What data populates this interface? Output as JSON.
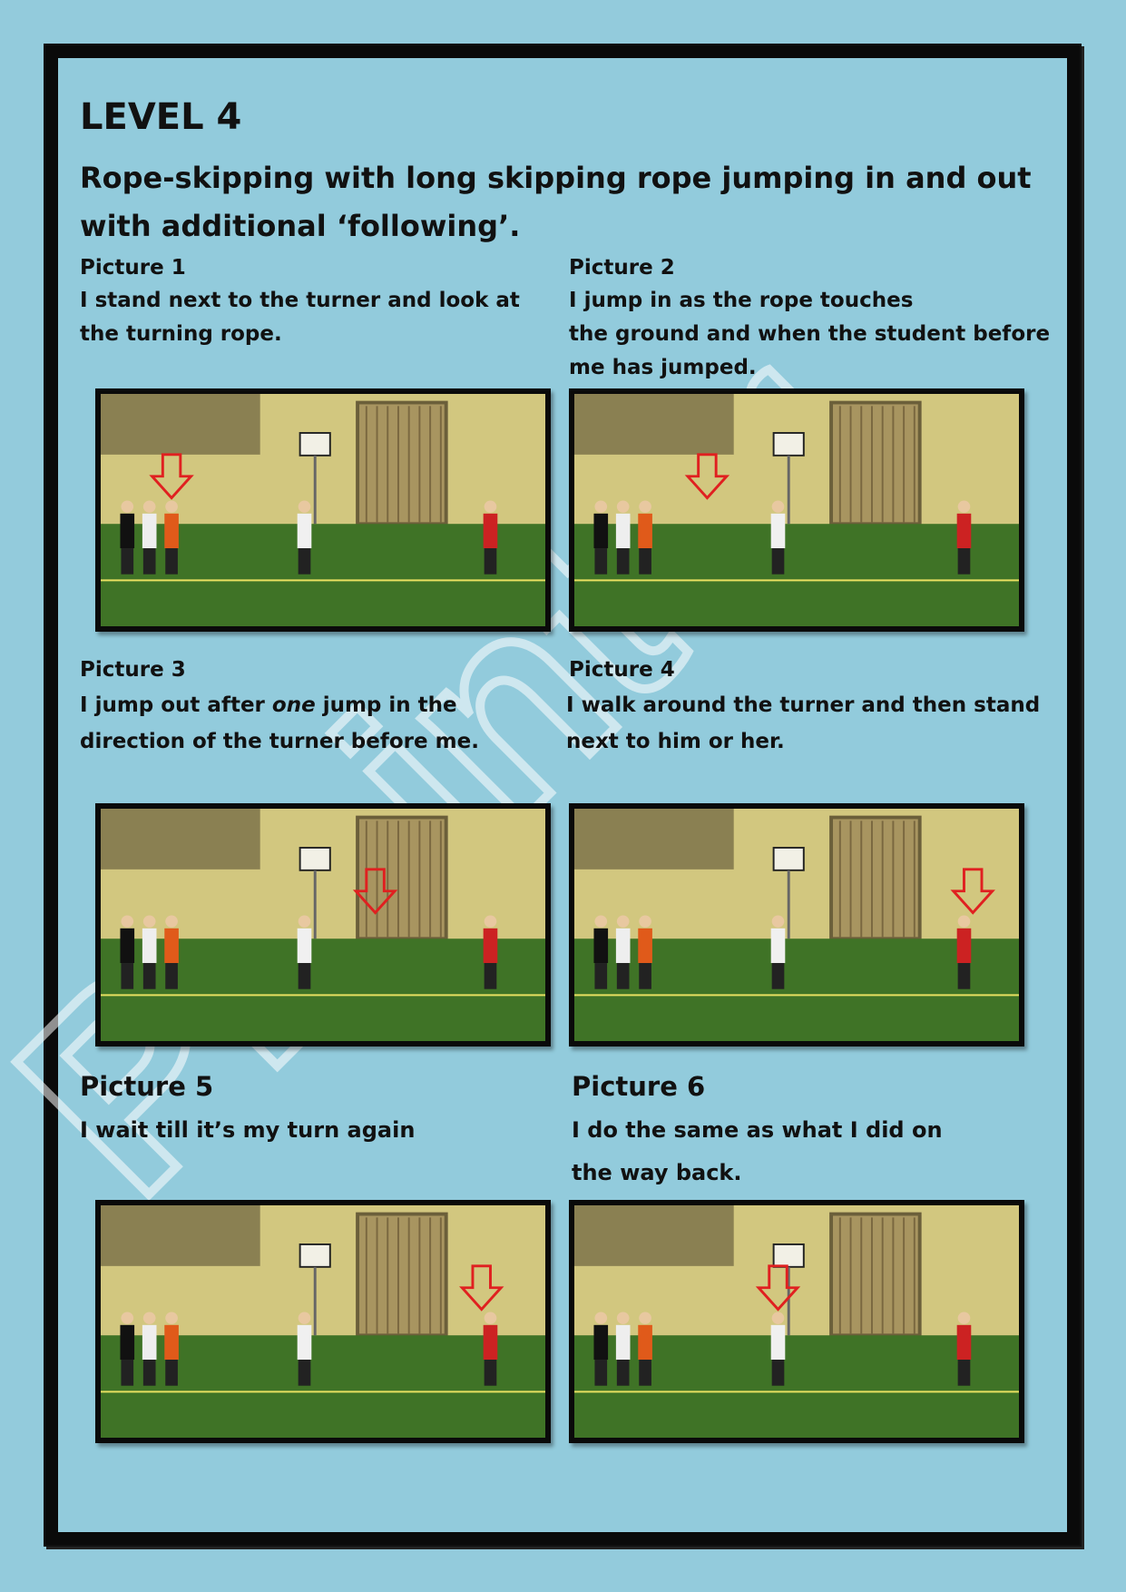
{
  "header": {
    "level": "LEVEL 4",
    "subtitle": "Rope-skipping with long skipping rope jumping in and out with additional ‘following’."
  },
  "watermark": {
    "text": "PE-inter",
    "color": "#ffffff"
  },
  "pictures": [
    {
      "label": "Picture 1",
      "lines": [
        "I stand next to the turner and look at",
        "the turning rope."
      ]
    },
    {
      "label": "Picture 2",
      "lines": [
        "I jump in as the rope touches",
        "the ground and when the student before",
        "me has jumped."
      ]
    },
    {
      "label": "Picture 3",
      "lines_rich": {
        "before": "I jump out after ",
        "emphasis": "one",
        "after": " jump in the"
      },
      "lines": [
        "direction of the turner before me."
      ]
    },
    {
      "label": "Picture 4",
      "lines": [
        "I walk around the turner and then stand",
        "next to him or her."
      ]
    },
    {
      "label": "Picture 5",
      "lines": [
        "I wait till it’s my turn again"
      ]
    },
    {
      "label": "Picture 6",
      "lines": [
        "I do the same as what I did on",
        "the way back."
      ]
    }
  ],
  "colors": {
    "background": "#93cbdc",
    "border": "#0a0a0a",
    "arrow": "#e02020"
  }
}
